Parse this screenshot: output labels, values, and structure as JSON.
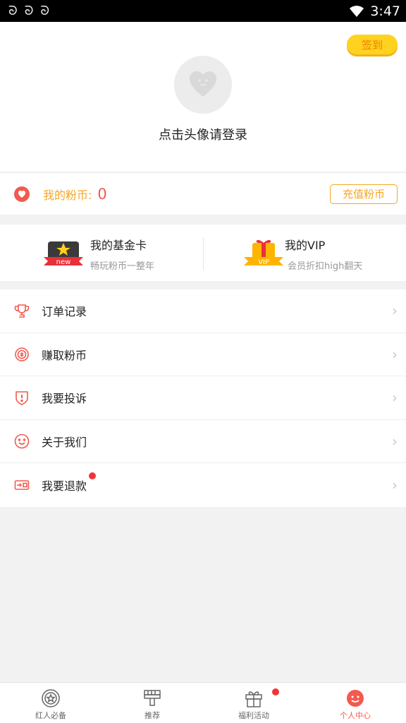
{
  "status_bar": {
    "time": "3:47",
    "notif_icons": [
      "app-icon",
      "app-icon",
      "app-icon"
    ]
  },
  "header": {
    "checkin_label": "签到",
    "login_prompt": "点击头像请登录"
  },
  "coins": {
    "label": "我的粉币:",
    "value": "0",
    "recharge_label": "充值粉币"
  },
  "cards": [
    {
      "title": "我的基金卡",
      "subtitle": "畅玩粉币一整年",
      "badge": "new",
      "icon": "fund-card-icon"
    },
    {
      "title": "我的VIP",
      "subtitle": "会员折扣high翻天",
      "badge": "VIP",
      "icon": "vip-gift-icon"
    }
  ],
  "menu": [
    {
      "label": "订单记录",
      "icon": "trophy-icon"
    },
    {
      "label": "赚取粉币",
      "icon": "coin-earn-icon"
    },
    {
      "label": "我要投诉",
      "icon": "complaint-shield-icon"
    },
    {
      "label": "关于我们",
      "icon": "smile-icon"
    },
    {
      "label": "我要退款",
      "icon": "refund-icon",
      "has_dot": true
    }
  ],
  "bottom_nav": [
    {
      "label": "红人必备",
      "icon": "star-badge-icon"
    },
    {
      "label": "推荐",
      "icon": "brush-icon"
    },
    {
      "label": "福利活动",
      "icon": "gift-icon",
      "has_dot": true
    },
    {
      "label": "个人中心",
      "icon": "face-icon",
      "active": true
    }
  ],
  "colors": {
    "accent": "#f25a4e",
    "orange": "#f5a623",
    "checkin_bg": "#ffd21f"
  }
}
